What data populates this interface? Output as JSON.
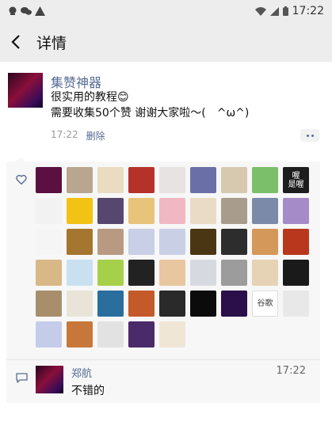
{
  "statusbar": {
    "time": "17:22"
  },
  "nav": {
    "title": "详情"
  },
  "post": {
    "username": "集赞神器",
    "content": "很实用的教程😊\n需要收集50个赞 谢谢大家啦～(　^ω^)",
    "time": "17:22",
    "delete_label": "删除"
  },
  "likes": {
    "colors": [
      "#5a1040",
      "#b8a68e",
      "#e9dcc0",
      "#b5322b",
      "#e8e3e3",
      "#6b6fa8",
      "#d7c8b0",
      "#7bbf6a",
      "#1d1d1d",
      "#f2f2f2",
      "#f2c214",
      "#55476e",
      "#e8c47a",
      "#f0b8c2",
      "#eadbc6",
      "#a89c8c",
      "#7b8aa8",
      "#a58cc8",
      "#f5f5f5",
      "#a5762f",
      "#b89a82",
      "#c8cfe6",
      "#c9d0e6",
      "#4a3612",
      "#2d2d2d",
      "#d4985a",
      "#b9381d",
      "#d8b886",
      "#c8e0f0",
      "#a7d04a",
      "#222222",
      "#e7c6a0",
      "#d6d9e0",
      "#9c9c9c",
      "#e6d2b5",
      "#1a1a1a",
      "#a88f6c",
      "#e8e4d8",
      "#2a6e9e",
      "#c45a2a",
      "#2a2a2a",
      "#0b0b0b",
      "#2a0f4a",
      "#ffffff",
      "#e8e8e8",
      "#c4ccea",
      "#c8773a",
      "#e2e2e2",
      "#4b2a6a",
      "#f0e6d6"
    ],
    "texts": {
      "8": "喔\n是喔",
      "43": "谷歌"
    }
  },
  "comment": {
    "name": "郑航",
    "time": "17:22",
    "text": "不错的"
  }
}
